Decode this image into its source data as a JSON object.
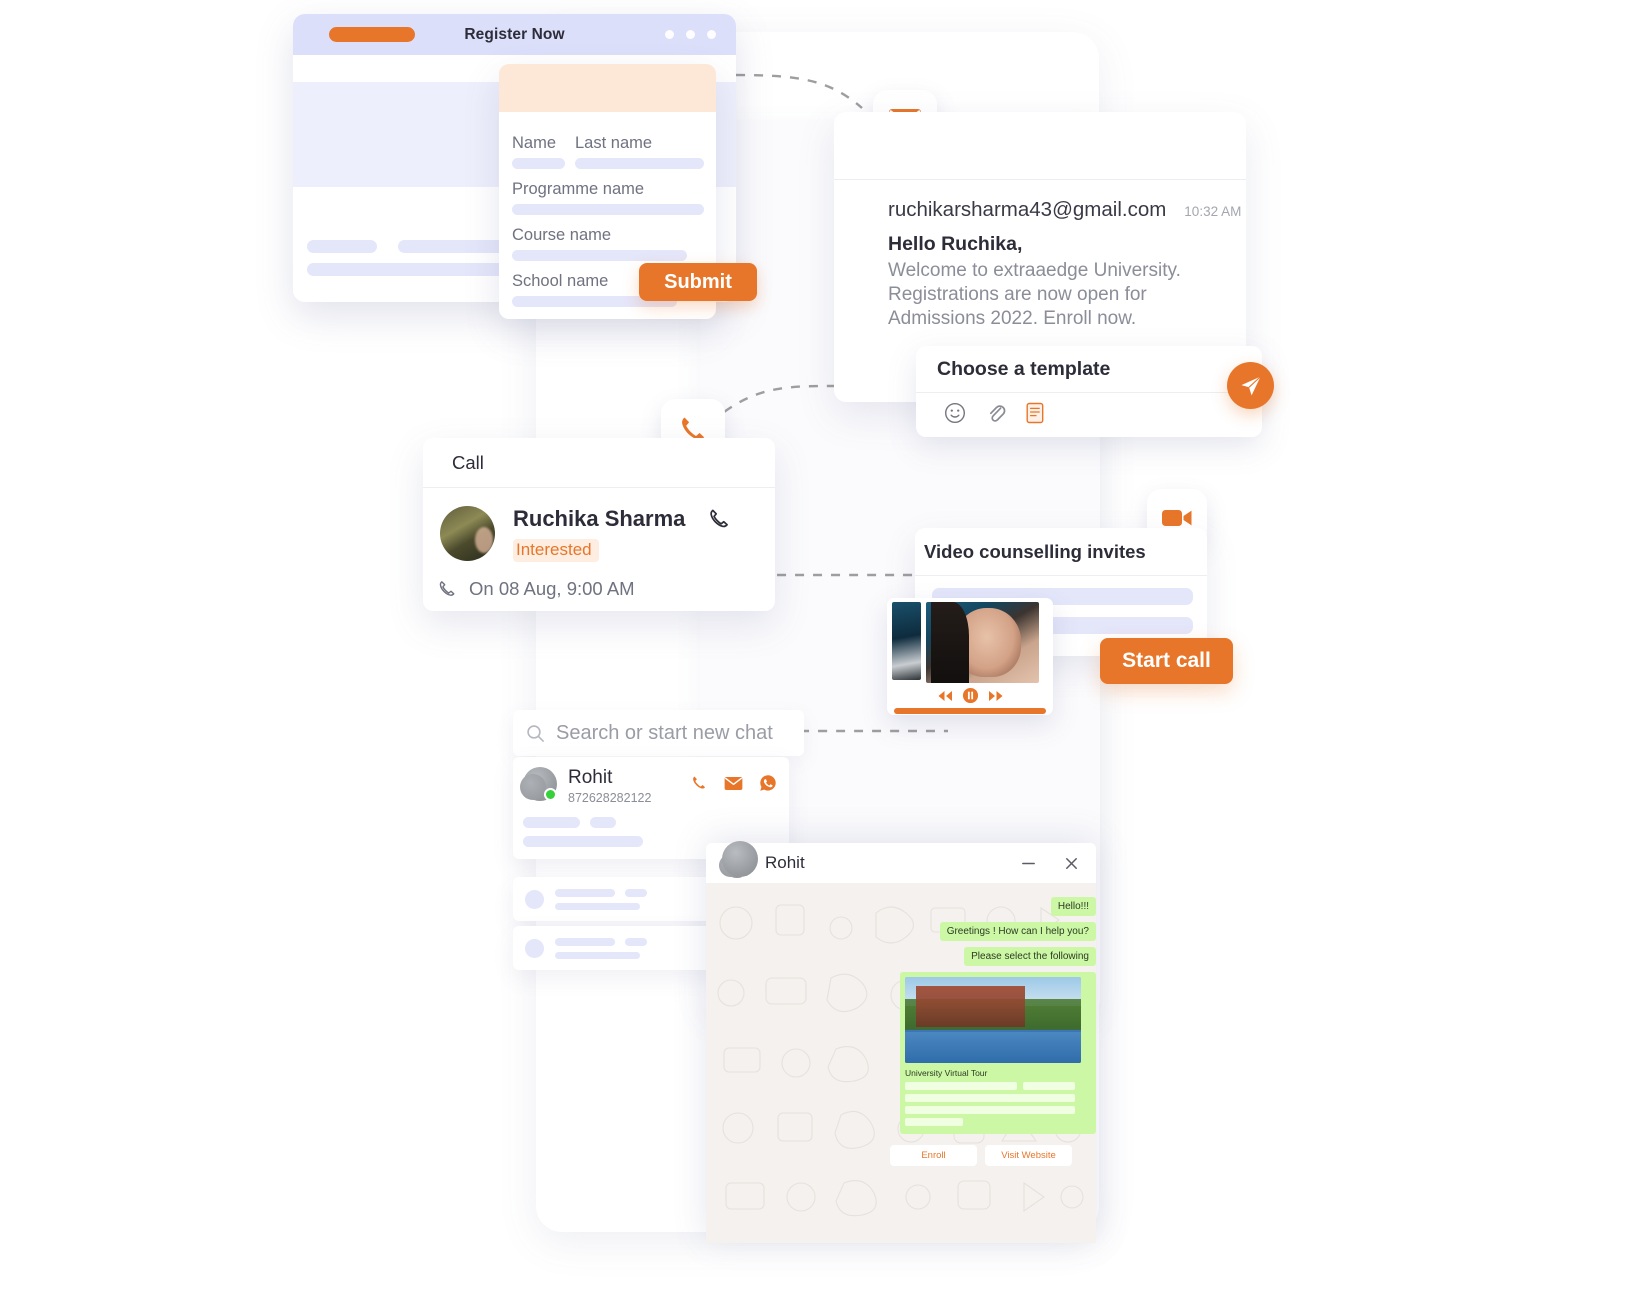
{
  "register_window": {
    "title": "Register Now",
    "window_dots": 3
  },
  "form": {
    "fields": [
      {
        "label": "Name"
      },
      {
        "label": "Last name"
      },
      {
        "label": "Programme name"
      },
      {
        "label": "Course name"
      },
      {
        "label": "School name"
      }
    ],
    "submit_label": "Submit"
  },
  "email": {
    "icon": "mail-icon",
    "address": "ruchikarsharma43@gmail.com",
    "time": "10:32 AM",
    "greeting": "Hello Ruchika,",
    "body": "Welcome to extraaedge University. Registrations are now open for Admissions 2022. Enroll now."
  },
  "template": {
    "title": "Choose a template",
    "icons": [
      "emoji-icon",
      "attachment-icon",
      "template-icon"
    ],
    "send_icon": "send-icon"
  },
  "call": {
    "icon": "phone-icon",
    "header": "Call",
    "contact_name": "Ruchika Sharma",
    "status_badge": "Interested",
    "scheduled": "On 08 Aug, 9:00 AM"
  },
  "video": {
    "icon": "video-camera-icon",
    "title": "Video counselling invites",
    "controls": [
      "rewind-icon",
      "pause-icon",
      "forward-icon"
    ],
    "start_call_label": "Start call"
  },
  "chat_list": {
    "search_placeholder": "Search or start new chat",
    "search_icon": "search-icon",
    "contact": {
      "name": "Rohit",
      "phone": "872628282122",
      "actions": [
        "phone-icon",
        "mail-icon",
        "whatsapp-icon"
      ],
      "online": true
    }
  },
  "whatsapp": {
    "contact_name": "Rohit",
    "minimize_label": "—",
    "close_label": "✕",
    "messages": [
      {
        "text": "Hello!!!"
      },
      {
        "text": "Greetings ! How can I help you?"
      },
      {
        "text": "Please select the following"
      }
    ],
    "media_caption": "University Virtual Tour",
    "buttons": [
      {
        "label": "Enroll"
      },
      {
        "label": "Visit Website"
      }
    ]
  },
  "colors": {
    "accent": "#e8762a",
    "titlebar": "#dcdffa",
    "skeleton": "#e4e6fa",
    "chat_bubble": "#ccf8a6",
    "online": "#35d03a"
  }
}
